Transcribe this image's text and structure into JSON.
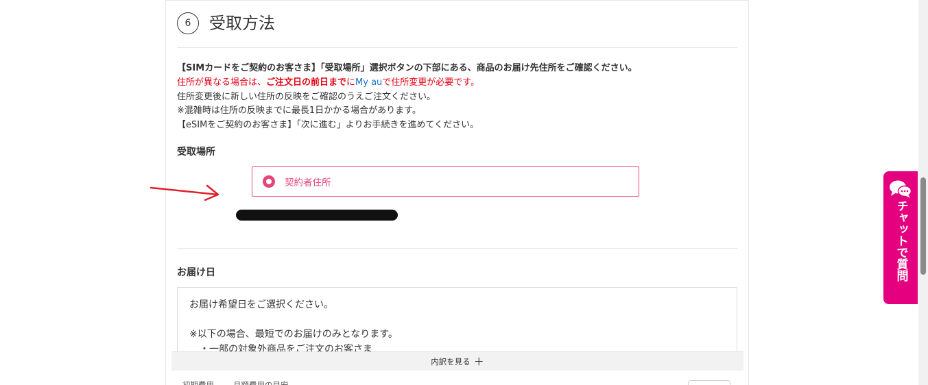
{
  "section": {
    "step_number": "6",
    "title": "受取方法"
  },
  "notice": {
    "line1": "【SIMカードをご契約のお客さま】「受取場所」選択ボタンの下部にある、商品のお届け先住所をご確認ください。",
    "line2_part1": "住所が異なる場合は、",
    "line2_bold": "ご注文日の前日まで",
    "line2_part2": "に",
    "line2_link": "My au",
    "line2_part3": "で住所変更が必要です。",
    "line3": "住所変更後に新しい住所の反映をご確認のうえご注文ください。",
    "line4": "※混雑時は住所の反映までに最長1日かかる場合があります。",
    "line5": "【eSIMをご契約のお客さま】「次に進む」よりお手続きを進めてください。"
  },
  "receive_place": {
    "label": "受取場所",
    "options": [
      {
        "label": "契約者住所",
        "selected": true
      }
    ]
  },
  "delivery": {
    "label": "お届け日",
    "line1": "お届け希望日をご選択ください。",
    "line2": "※以下の場合、最短でのお届けのみとなります。",
    "line3": "・一部の対象外商品をご注文のお客さま"
  },
  "breakdown": {
    "label": "内訳を見る",
    "icon": "plus-icon"
  },
  "footer": {
    "initial_cost": "初期費用",
    "monthly_cost": "月額費用の目安"
  },
  "chat": {
    "label": "チャットで質問",
    "icon": "chat-bubbles-icon"
  },
  "colors": {
    "accent_pink": "#e5457a",
    "chat_magenta": "#e4007f",
    "warning_red": "#e60012",
    "link_blue": "#1a6fc9"
  }
}
